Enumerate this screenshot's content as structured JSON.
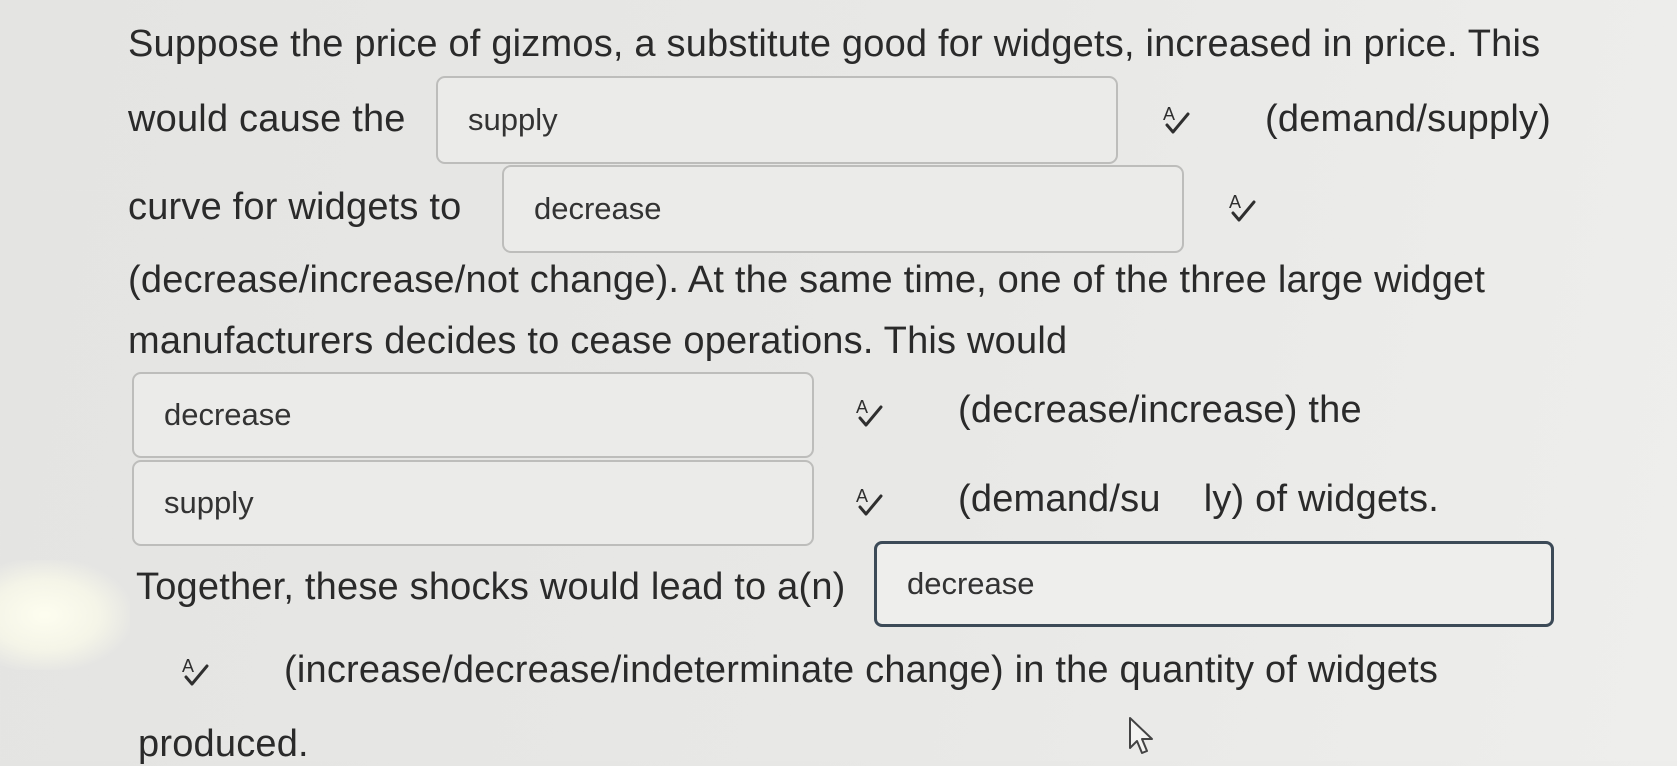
{
  "question": {
    "line1": "Suppose the price of gizmos, a substitute good for widgets, increased in price. This",
    "line2_before": "would cause the",
    "line2_after": "(demand/supply)",
    "line3_before": "curve for widgets to",
    "line4": "(decrease/increase/not change). At the same time, one of the three large widget",
    "line5": "manufacturers decides to cease operations. This would",
    "line6_after": "(decrease/increase) the",
    "line7_after": "(demand/su    ly) of widgets.",
    "line8_before": "Together, these shocks would lead to a(n)",
    "line9_after": "(increase/decrease/indeterminate change) in the quantity of widgets",
    "line10": "produced."
  },
  "blanks": [
    {
      "value": "supply"
    },
    {
      "value": "decrease"
    },
    {
      "value": "decrease"
    },
    {
      "value": "supply"
    },
    {
      "value": "decrease"
    }
  ],
  "icons": {
    "spellcheck": "spellcheck-icon",
    "cursor": "mouse-pointer-icon"
  },
  "colors": {
    "text": "#2a2a2a",
    "field_border": "#bdbdbb",
    "active_border": "#3c4a57"
  }
}
